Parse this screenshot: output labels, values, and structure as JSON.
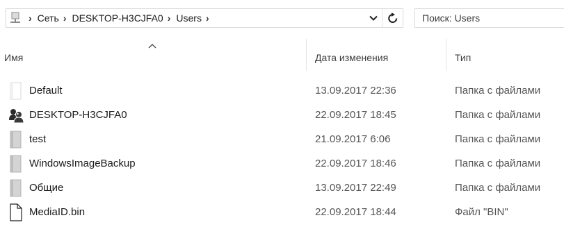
{
  "address_bar": {
    "breadcrumbs": [
      "Сеть",
      "DESKTOP-H3CJFA0",
      "Users"
    ],
    "root_icon": "network-computer-icon",
    "dropdown_icon": "chevron-down-icon",
    "refresh_icon": "refresh-icon"
  },
  "search": {
    "placeholder": "Поиск: Users"
  },
  "columns": {
    "name": "Имя",
    "date": "Дата изменения",
    "type": "Тип"
  },
  "files": [
    {
      "name": "Default",
      "date": "13.09.2017 22:36",
      "type": "Папка с файлами",
      "icon": "folder-hidden-icon"
    },
    {
      "name": "DESKTOP-H3CJFA0",
      "date": "22.09.2017 18:45",
      "type": "Папка с файлами",
      "icon": "users-folder-icon"
    },
    {
      "name": "test",
      "date": "21.09.2017 6:06",
      "type": "Папка с файлами",
      "icon": "folder-icon"
    },
    {
      "name": "WindowsImageBackup",
      "date": "22.09.2017 18:46",
      "type": "Папка с файлами",
      "icon": "folder-icon"
    },
    {
      "name": "Общие",
      "date": "13.09.2017 22:49",
      "type": "Папка с файлами",
      "icon": "folder-icon"
    },
    {
      "name": "MediaID.bin",
      "date": "22.09.2017 18:44",
      "type": "Файл \"BIN\"",
      "icon": "file-icon"
    }
  ],
  "colors": {
    "folder_grey": "#d2d2d2",
    "folder_grey_dark": "#a9a9a9",
    "border": "#d9d9d9"
  }
}
